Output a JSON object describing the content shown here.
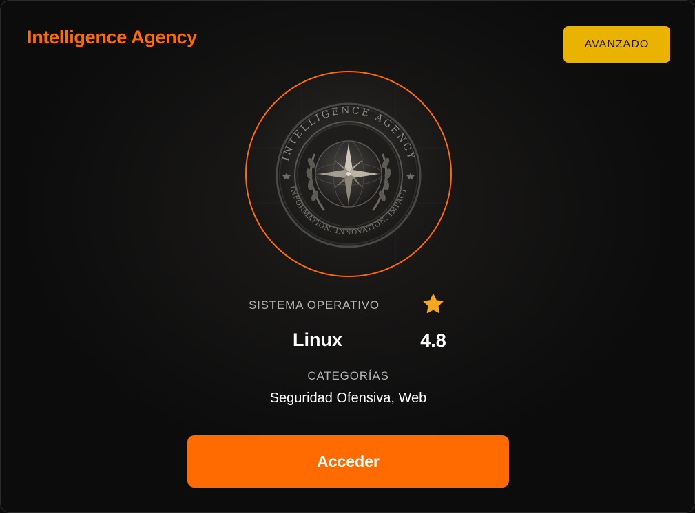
{
  "colors": {
    "accent": "#ff6b00",
    "badge_bg": "#e9b300",
    "star": "#f5a623"
  },
  "card": {
    "title": "Intelligence Agency",
    "difficulty": "AVANZADO",
    "avatar_icon": "intelligence-agency-seal-icon",
    "seal": {
      "top_text": "INTELLIGENCE AGENCY",
      "bottom_text": "INFORMATION. INNOVATION. IMPACT."
    },
    "os_label": "SISTEMA OPERATIVO",
    "os_value": "Linux",
    "rating_icon": "star-icon",
    "rating": "4.8",
    "categories_label": "CATEGORÍAS",
    "categories_value": "Seguridad Ofensiva, Web",
    "access_label": "Acceder"
  }
}
